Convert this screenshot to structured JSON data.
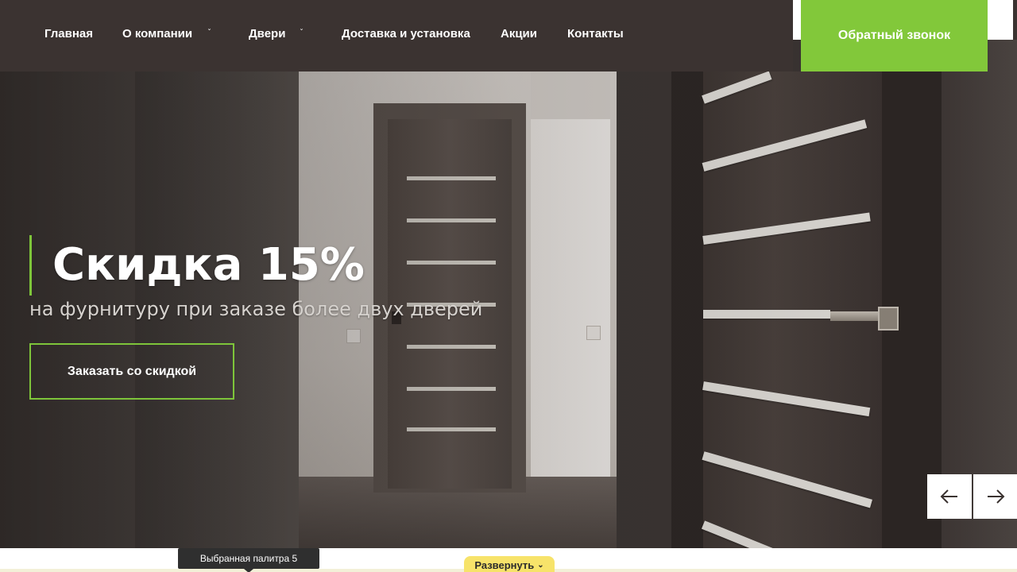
{
  "nav": {
    "items": [
      {
        "label": "Главная",
        "has_dropdown": false
      },
      {
        "label": "О компании",
        "has_dropdown": true
      },
      {
        "label": "Двери",
        "has_dropdown": true
      },
      {
        "label": "Доставка и установка",
        "has_dropdown": false
      },
      {
        "label": "Акции",
        "has_dropdown": false
      },
      {
        "label": "Контакты",
        "has_dropdown": false
      }
    ],
    "dropdown_glyph": "ˇ",
    "callback_label": "Обратный звонок"
  },
  "hero": {
    "title": "Скидка 15%",
    "subtitle": "на фурнитуру при заказе более двух дверей",
    "cta_label": "Заказать со скидкой",
    "prev_icon": "arrow-left-icon",
    "next_icon": "arrow-right-icon"
  },
  "footer_bar": {
    "tooltip": "Выбранная палитра 5",
    "expand_label": "Развернуть",
    "expand_glyph": "⌄"
  },
  "colors": {
    "accent": "#82c83a",
    "nav_bg": "#3b3331",
    "text_light": "#ffffff",
    "expand_bg": "#f7e36a"
  }
}
